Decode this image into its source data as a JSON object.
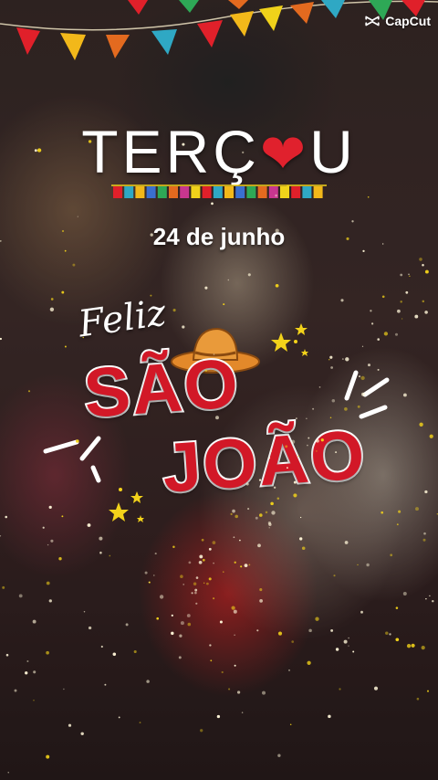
{
  "watermark": {
    "label": "CapCut",
    "icon": "capcut-logo-icon"
  },
  "headline": {
    "prefix": "TERÇ",
    "heart": "❤",
    "suffix": "U"
  },
  "date_text": "24 de junho",
  "greeting": {
    "feliz": "Feliz",
    "sao": "SÃO",
    "joao": "JOÃO"
  },
  "colors": {
    "accent_red": "#d21827",
    "heart_red": "#e0212d",
    "star_yellow": "#f2d21a",
    "hat_orange": "#e3892a",
    "flag_colors": [
      "#e0202a",
      "#2fa8c4",
      "#f2b81a",
      "#3a6fd0",
      "#2ea856",
      "#e36a1f",
      "#c8368f",
      "#f0d21a"
    ]
  }
}
